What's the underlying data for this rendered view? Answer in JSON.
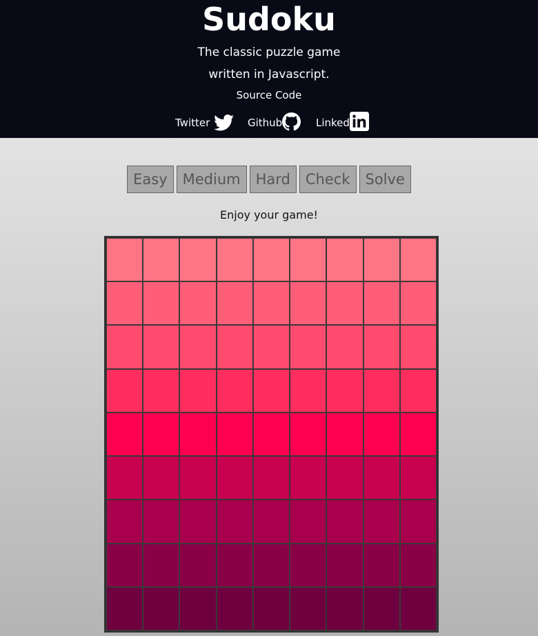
{
  "header": {
    "title": "Sudoku",
    "tagline_line1": "The classic puzzle game",
    "tagline_line2": "written in Javascript.",
    "source_link": "Source Code",
    "social": {
      "twitter": {
        "label": "Twitter",
        "icon": "twitter-bird-icon"
      },
      "github": {
        "label": "Github",
        "icon": "github-octocat-icon"
      },
      "linkedin": {
        "label": "Linked",
        "icon": "linkedin-in-icon"
      }
    }
  },
  "controls": {
    "easy": "Easy",
    "medium": "Medium",
    "hard": "Hard",
    "check": "Check",
    "solve": "Solve"
  },
  "message": "Enjoy your game!",
  "board": {
    "size": 9,
    "row_colors": [
      "#ff7585",
      "#ff5e78",
      "#ff4b6d",
      "#ff2e5f",
      "#ff0050",
      "#c7004f",
      "#a8004c",
      "#8a0046",
      "#6f0040"
    ]
  }
}
